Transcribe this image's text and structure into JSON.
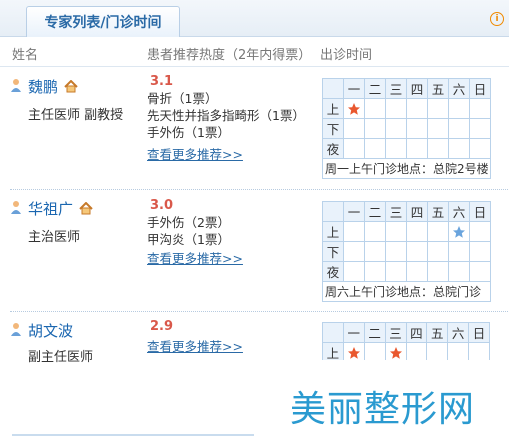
{
  "header": {
    "tab_label": "专家列表/门诊时间",
    "info_icon": "i"
  },
  "columns": {
    "name": "姓名",
    "heat": "患者推荐热度（2年内得票）",
    "time": "出诊时间"
  },
  "days": [
    "一",
    "二",
    "三",
    "四",
    "五",
    "六",
    "日"
  ],
  "periods": [
    "上",
    "下",
    "夜"
  ],
  "doctors": [
    {
      "name": "魏鹏",
      "title": "主任医师 副教授",
      "score": "3.1",
      "recs": [
        "骨折（1票）",
        "先天性并指多指畸形（1票）",
        "手外伤（1票）"
      ],
      "more": "查看更多推荐>>",
      "note": "周一上午门诊地点：总院2号楼"
    },
    {
      "name": "华祖广",
      "title": "主治医师",
      "score": "3.0",
      "recs": [
        "手外伤（2票）",
        "甲沟炎（1票）"
      ],
      "more": "查看更多推荐>>",
      "note": "周六上午门诊地点：总院门诊"
    },
    {
      "name": "胡文波",
      "title": "副主任医师",
      "score": "2.9",
      "recs": [],
      "more": "查看更多推荐>>",
      "note": ""
    }
  ],
  "watermark": "美丽整形网"
}
